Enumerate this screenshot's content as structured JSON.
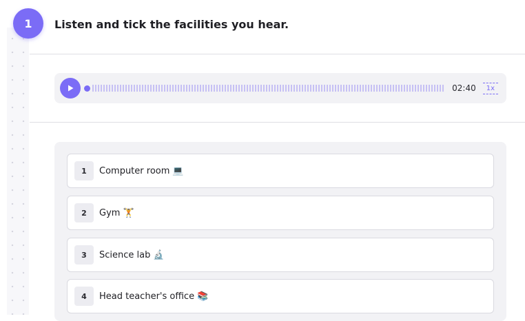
{
  "question": {
    "number": "1",
    "title": "Listen and tick the facilities you hear."
  },
  "audio": {
    "time": "02:40",
    "speed": "1x",
    "progress_fraction": 0.0
  },
  "options": [
    {
      "number": "1",
      "label": "Computer room",
      "emoji": "💻"
    },
    {
      "number": "2",
      "label": "Gym",
      "emoji": "🏋"
    },
    {
      "number": "3",
      "label": "Science lab",
      "emoji": "🔬"
    },
    {
      "number": "4",
      "label": "Head teacher's office",
      "emoji": "📚"
    }
  ],
  "colors": {
    "accent": "#7b6cf6",
    "panel": "#f2f2f5"
  }
}
